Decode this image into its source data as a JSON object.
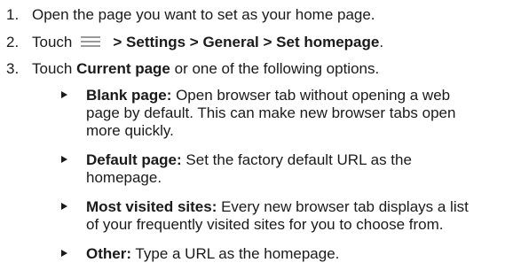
{
  "steps": [
    {
      "num": "1.",
      "text": "Open the page you want to set as your home page."
    },
    {
      "num": "2.",
      "prefix": "Touch",
      "menu_path": "> Settings > General > Set homepage",
      "suffix": "."
    },
    {
      "num": "3.",
      "prefix": "Touch ",
      "bold": "Current page",
      "suffix": " or one of the following options."
    }
  ],
  "menu_icon": "menu-icon",
  "options": [
    {
      "label": "Blank page:",
      "line1": " Open browser tab without opening a web",
      "line2": "page by default. This can make new browser tabs open",
      "line3": "more quickly."
    },
    {
      "label": "Default page:",
      "line1": " Set the factory default URL as the",
      "line2": "homepage."
    },
    {
      "label": "Most visited sites:",
      "line1": " Every new browser tab displays a list",
      "line2": "of your frequently visited sites for you to choose from."
    },
    {
      "label": "Other:",
      "line1": " Type a URL as the homepage."
    }
  ]
}
